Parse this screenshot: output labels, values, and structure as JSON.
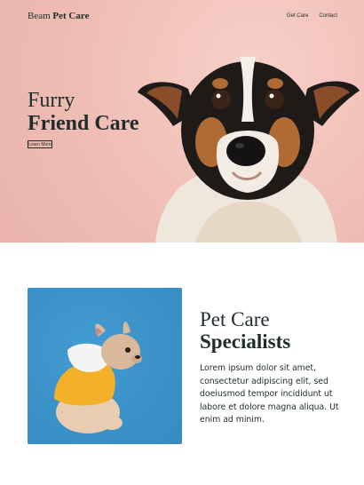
{
  "header": {
    "brand_prefix": "Beam",
    "brand_strong": "Pet Care",
    "nav": [
      {
        "label": "Get Care"
      },
      {
        "label": "Contact"
      }
    ]
  },
  "hero": {
    "title_line1": "Furry",
    "title_line2": "Friend Care",
    "button_label": "Learn More"
  },
  "section": {
    "title_line1": "Pet Care",
    "title_line2": "Specialists",
    "body": "Lorem ipsum dolor sit amet, consectetur adipiscing elit, sed doeiusmod tempor incididunt ut labore et dolore magna aliqua. Ut enim ad minim."
  },
  "colors": {
    "hero_bg": "#f2c1b9",
    "text": "#1f2d2a",
    "photo_bg": "#3a93c9",
    "hoodie": "#f2b02b"
  },
  "images": {
    "hero": "jack-russell-dog-photo",
    "section": "french-bulldog-in-yellow-hoodie-photo"
  }
}
